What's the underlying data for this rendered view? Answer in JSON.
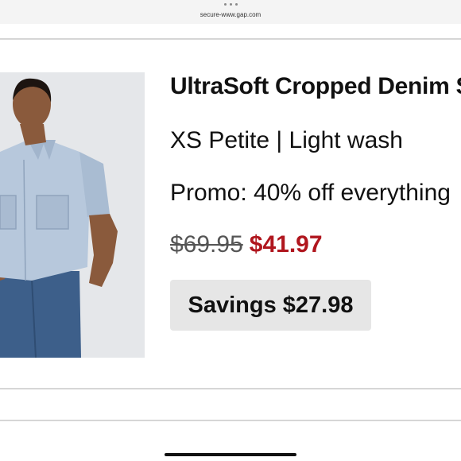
{
  "browser": {
    "url": "secure-www.gap.com",
    "menu_icon": "more-dots-icon"
  },
  "product": {
    "image_icon": "product-photo-denim-shirt",
    "title": "UltraSoft Cropped Denim Shirt",
    "variant": "XS Petite | Light wash",
    "promo": "Promo: 40% off everything",
    "original_price": "$69.95",
    "sale_price": "$41.97",
    "savings": "Savings $27.98"
  },
  "colors": {
    "sale_price": "#b0161e",
    "savings_bg": "#e6e6e6"
  }
}
